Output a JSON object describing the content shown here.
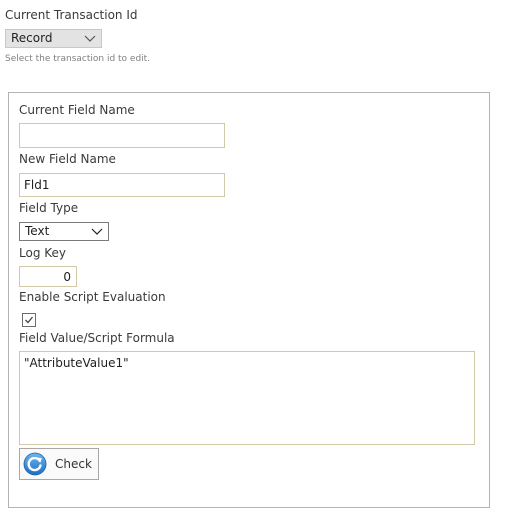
{
  "transaction": {
    "label": "Current Transaction Id",
    "selected": "Record",
    "hint": "Select the transaction id to edit."
  },
  "form": {
    "current_field_name_label": "Current Field Name",
    "current_field_name_value": "",
    "new_field_name_label": "New Field Name",
    "new_field_name_value": "Fld1",
    "field_type_label": "Field Type",
    "field_type_selected": "Text",
    "log_key_label": "Log Key",
    "log_key_value": "0",
    "enable_script_label": "Enable Script Evaluation",
    "enable_script_checked": true,
    "formula_label": "Field Value/Script Formula",
    "formula_value": "\"AttributeValue1\"",
    "check_button_label": "Check"
  },
  "icons": {
    "dropdown": "chevron-down-icon",
    "check_button": "refresh-icon",
    "checkbox": "checkmark-icon"
  },
  "colors": {
    "input_border": "#d2c9a8",
    "icon_blue": "#2f86d6"
  }
}
